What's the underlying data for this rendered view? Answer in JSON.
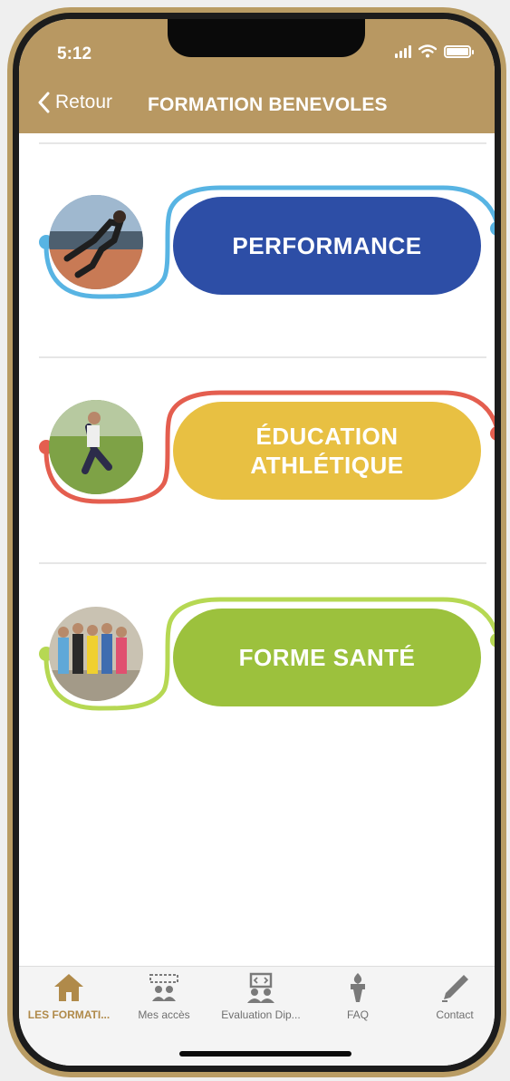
{
  "status_bar": {
    "time": "5:12"
  },
  "nav": {
    "back_label": "Retour",
    "title": "FORMATION BENEVOLES"
  },
  "cards": [
    {
      "label": "PERFORMANCE",
      "color": "#2d4ea6",
      "track_color": "#58b4e3"
    },
    {
      "label": "ÉDUCATION ATHLÉTIQUE",
      "color": "#e8c042",
      "track_color": "#e45e4f"
    },
    {
      "label": "FORME SANTÉ",
      "color": "#9cc13d",
      "track_color": "#b6d853"
    }
  ],
  "tabs": [
    {
      "label": "LES FORMATI...",
      "icon": "home-icon",
      "active": true
    },
    {
      "label": "Mes accès",
      "icon": "access-icon",
      "active": false
    },
    {
      "label": "Evaluation Dip...",
      "icon": "evaluation-icon",
      "active": false
    },
    {
      "label": "FAQ",
      "icon": "torch-icon",
      "active": false
    },
    {
      "label": "Contact",
      "icon": "pen-icon",
      "active": false
    }
  ],
  "colors": {
    "accent": "#b89862",
    "active_tab": "#b08a4a",
    "inactive_tab": "#6f6f6f"
  }
}
